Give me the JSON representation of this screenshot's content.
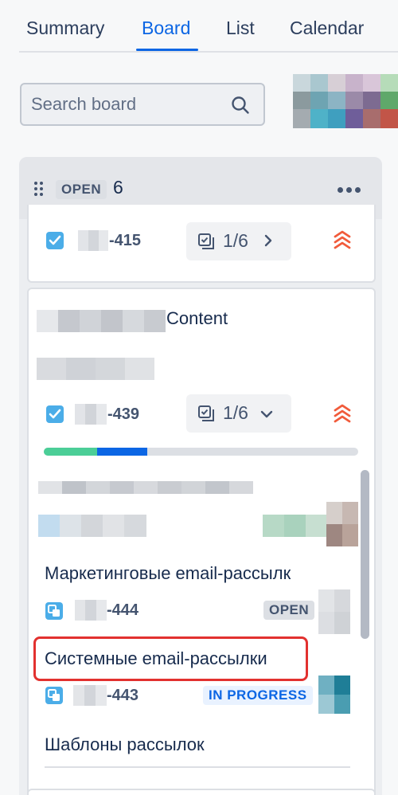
{
  "tabs": [
    {
      "label": "Summary",
      "active": false
    },
    {
      "label": "Board",
      "active": true
    },
    {
      "label": "List",
      "active": false
    },
    {
      "label": "Calendar",
      "active": false
    }
  ],
  "search": {
    "placeholder": "Search board",
    "value": ""
  },
  "column": {
    "status": "OPEN",
    "count": "6",
    "cards": [
      {
        "key": "-415",
        "subtasks": "1/6",
        "priority": "highest"
      },
      {
        "title_suffix": "Content",
        "key": "-439",
        "subtasks": "1/6",
        "priority": "highest",
        "progress_done": 0.17,
        "progress_in_progress": 0.16,
        "children": [
          {
            "title": "Маркетинговые email-рассылк",
            "key": "-444",
            "status": "OPEN"
          },
          {
            "title": "Системные email-рассылки",
            "key": "-443",
            "status": "IN PROGRESS"
          },
          {
            "title": "Шаблоны рассылок"
          }
        ]
      }
    ]
  },
  "colors": {
    "accent": "#0c66e4",
    "highlight": "#e2312f",
    "priority": "#f15b3b"
  }
}
